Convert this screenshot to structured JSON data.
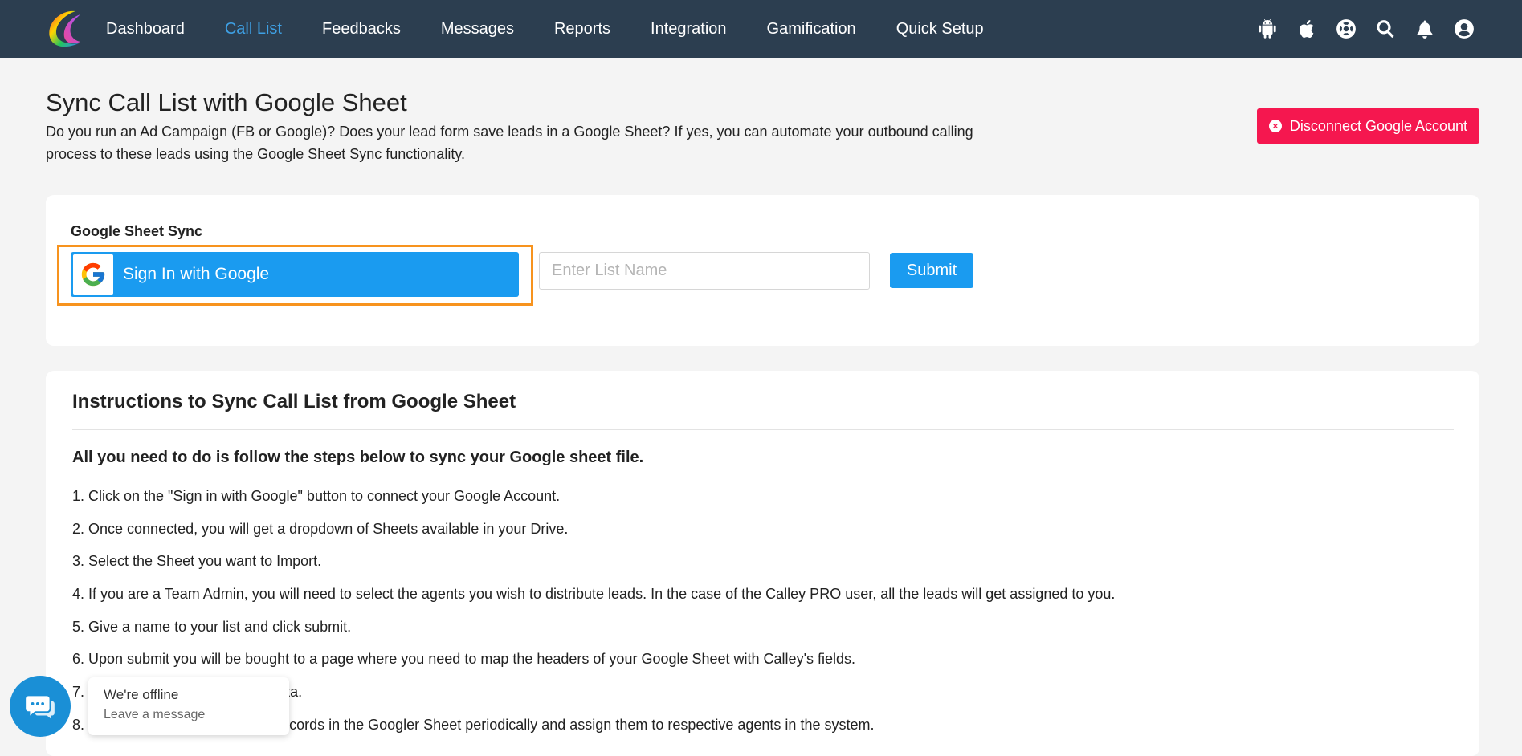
{
  "nav": {
    "items": [
      {
        "label": "Dashboard",
        "active": false
      },
      {
        "label": "Call List",
        "active": true
      },
      {
        "label": "Feedbacks",
        "active": false
      },
      {
        "label": "Messages",
        "active": false
      },
      {
        "label": "Reports",
        "active": false
      },
      {
        "label": "Integration",
        "active": false
      },
      {
        "label": "Gamification",
        "active": false
      },
      {
        "label": "Quick Setup",
        "active": false
      }
    ],
    "icons": [
      "android-icon",
      "apple-icon",
      "help-lifebuoy-icon",
      "search-icon",
      "bell-icon",
      "user-avatar-icon"
    ],
    "active_color": "#3ea0e4",
    "bg_color": "#2c3e50"
  },
  "header": {
    "title": "Sync Call List with Google Sheet",
    "description": "Do you run an Ad Campaign (FB or Google)? Does your lead form save leads in a Google Sheet? If yes, you can automate your outbound calling process to these leads using the Google Sheet Sync functionality.",
    "disconnect_label": "Disconnect Google Account",
    "disconnect_color": "#f5174f"
  },
  "sync": {
    "label": "Google Sheet Sync",
    "google_button_label": "Sign In with Google",
    "list_name_placeholder": "Enter List Name",
    "list_name_value": "",
    "submit_label": "Submit",
    "button_color": "#1a9bf0",
    "highlight_color": "#f7931e"
  },
  "instructions": {
    "title": "Instructions to Sync Call List from Google Sheet",
    "subtitle": "All you need to do is follow the steps below to sync your Google sheet file.",
    "steps": [
      "1. Click on the \"Sign in with Google\" button to connect your Google Account.",
      "2. Once connected, you will get a dropdown of Sheets available in your Drive.",
      "3. Select the Sheet you want to Import.",
      "4. If you are a Team Admin, you will need to select the agents you wish to distribute leads. In the case of the Calley PRO user, all the leads will get assigned to you.",
      "5. Give a name to your list and click submit.",
      "6. Upon submit you will be bought to a page where you need to map the headers of your Google Sheet with Calley's fields.",
      "7.                                    mport data.",
      "8.                                    or new records in the Googler Sheet periodically and assign them to respective agents in the system."
    ]
  },
  "chat": {
    "status": "We're offline",
    "action": "Leave a message"
  }
}
